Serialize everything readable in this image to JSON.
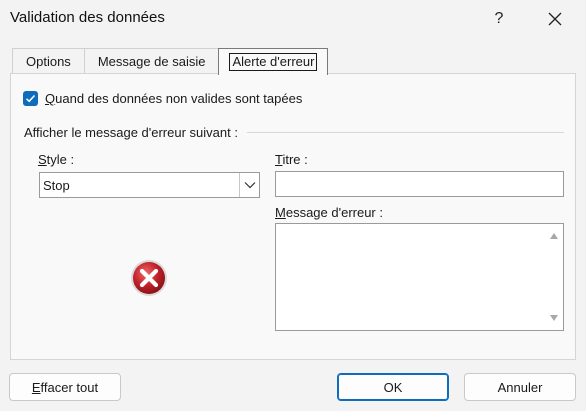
{
  "window": {
    "title": "Validation des données",
    "help_label": "?"
  },
  "tabs": [
    {
      "label": "Options",
      "active": false
    },
    {
      "label": "Message de saisie",
      "active": false
    },
    {
      "label": "Alerte d'erreur",
      "active": true
    }
  ],
  "alert": {
    "show_checkbox": {
      "checked": true,
      "label_first": "Q",
      "label_rest": "uand des données non valides sont tapées"
    },
    "section_label": "Afficher le message d'erreur suivant :",
    "style": {
      "label_first": "S",
      "label_rest": "tyle :",
      "value": "Stop",
      "icon": "stop-error-icon"
    },
    "titre": {
      "label_first": "T",
      "label_rest": "itre :",
      "value": ""
    },
    "message": {
      "label_first": "M",
      "label_rest": "essage d'erreur :",
      "value": ""
    }
  },
  "buttons": {
    "clear_first": "E",
    "clear_rest": "ffacer tout",
    "ok": "OK",
    "cancel": "Annuler"
  },
  "colors": {
    "accent": "#0f6cbd",
    "stop_red": "#c0202a"
  }
}
